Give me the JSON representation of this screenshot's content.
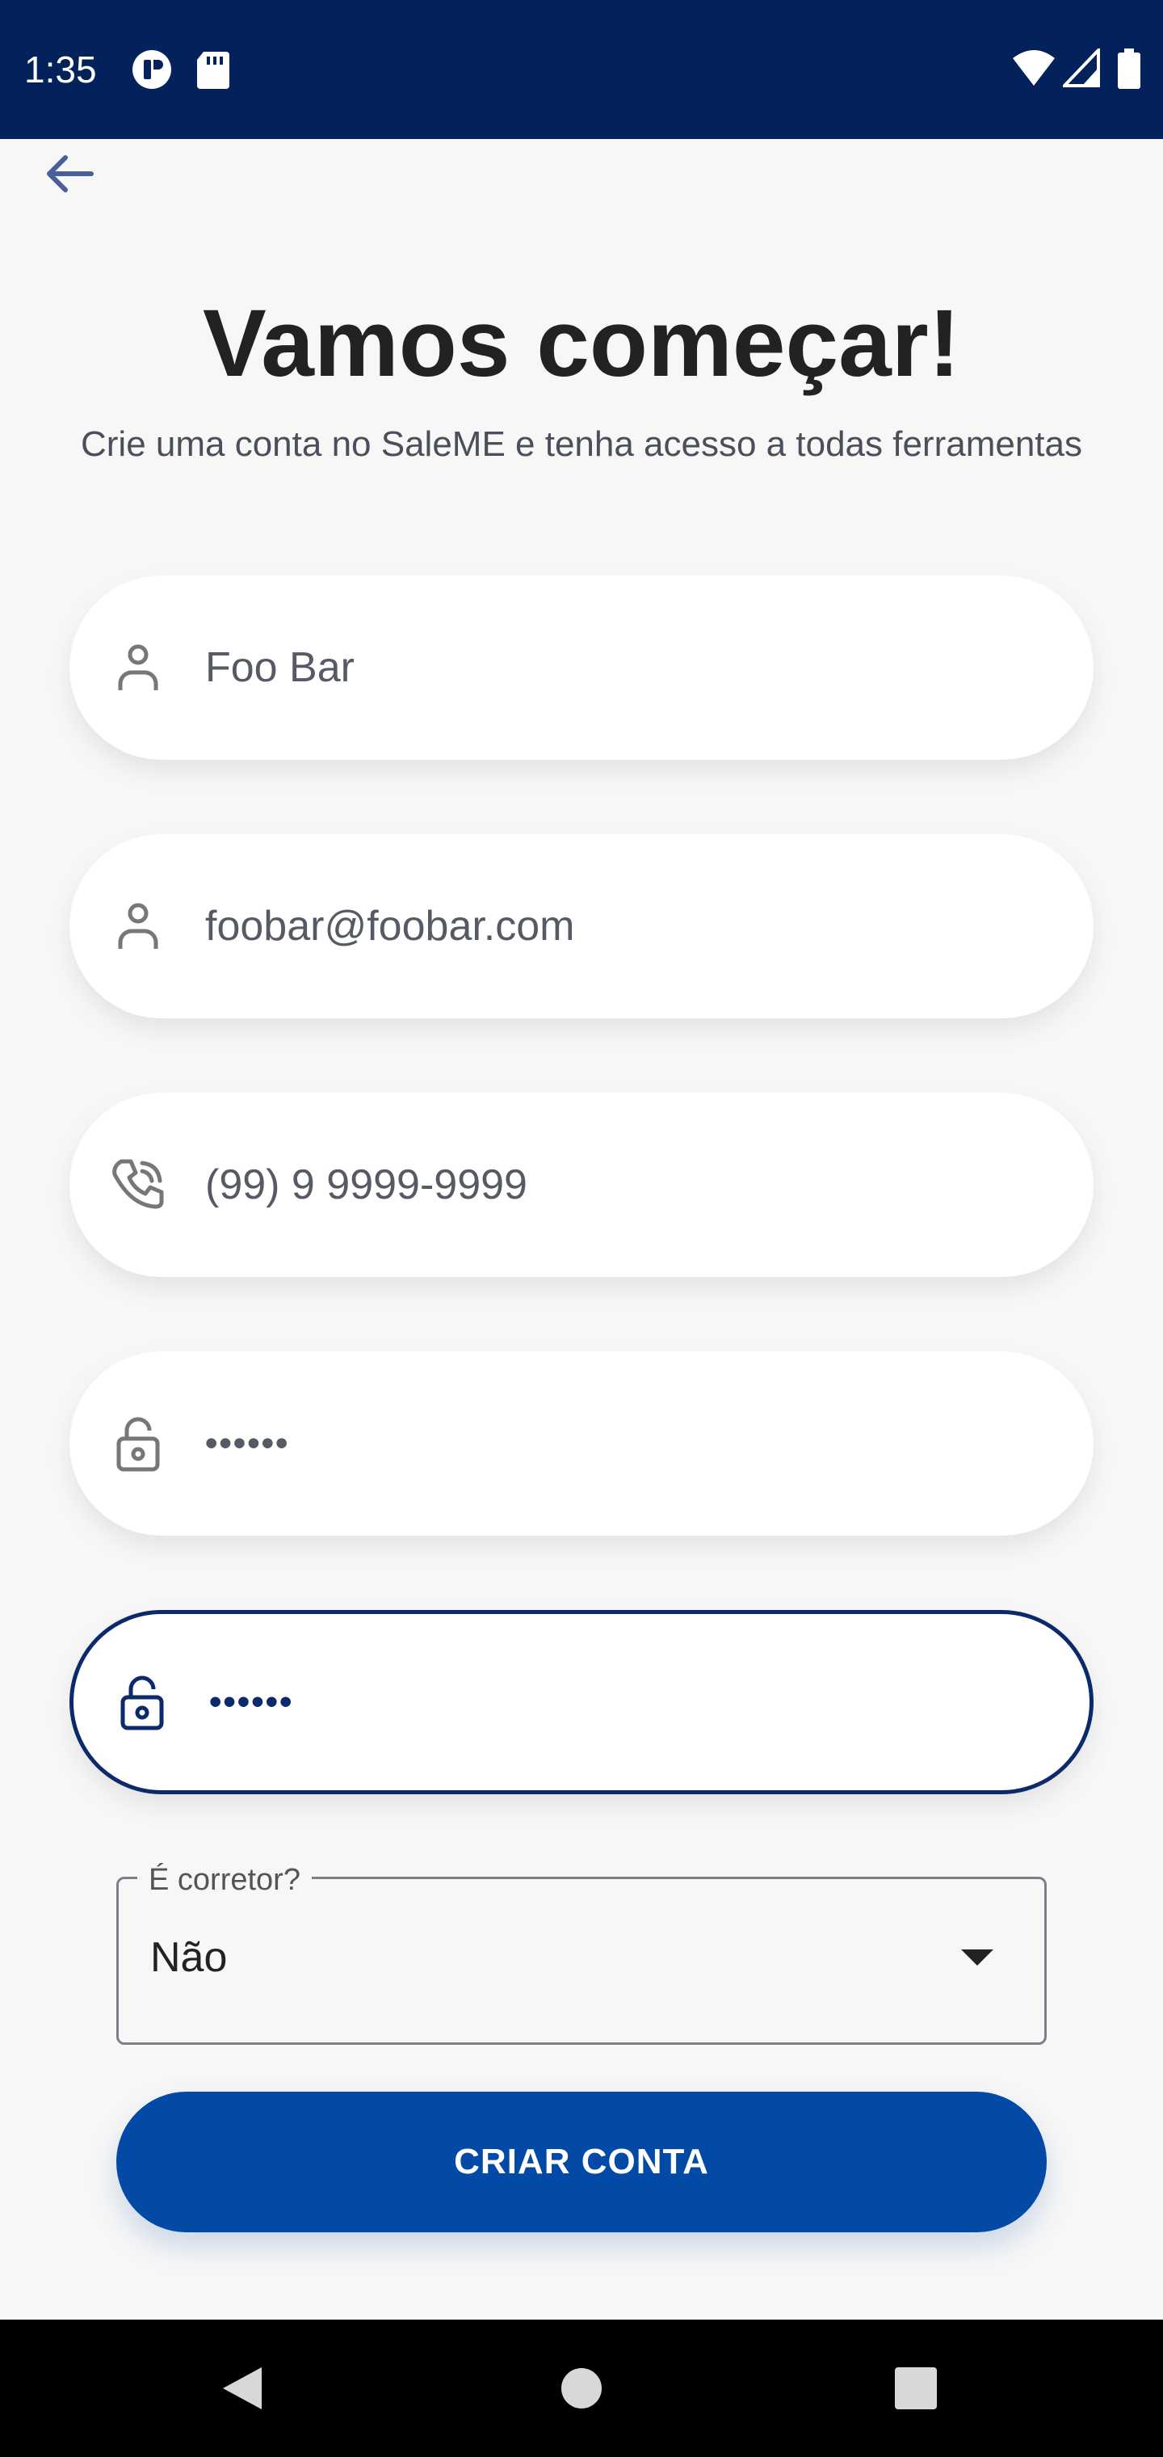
{
  "status_bar": {
    "time": "1:35",
    "icons": [
      "app-notification-icon",
      "sd-card-icon",
      "wifi-icon",
      "signal-icon",
      "battery-icon"
    ],
    "background": "#03215a"
  },
  "header": {
    "back_icon": "arrow-left-icon",
    "title": "Vamos começar!",
    "subtitle": "Crie uma conta no SaleME e tenha acesso a todas ferramentas"
  },
  "form": {
    "name": {
      "icon": "person-icon",
      "value": "Foo Bar"
    },
    "email": {
      "icon": "person-icon",
      "value": "foobar@foobar.com"
    },
    "phone": {
      "icon": "phone-icon",
      "value": "(99) 9 9999-9999"
    },
    "password": {
      "icon": "lock-icon",
      "value": "••••••"
    },
    "confirm_password": {
      "icon": "lock-icon",
      "value": "••••••"
    },
    "broker_select": {
      "label": "É corretor?",
      "value": "Não"
    },
    "submit_label": "CRIAR CONTA"
  },
  "colors": {
    "accent": "#0349a6",
    "focus_border": "#0b2a6b",
    "background": "#f7f7f7"
  },
  "nav_bar": {
    "icons": [
      "back-triangle-icon",
      "home-circle-icon",
      "recents-square-icon"
    ]
  }
}
